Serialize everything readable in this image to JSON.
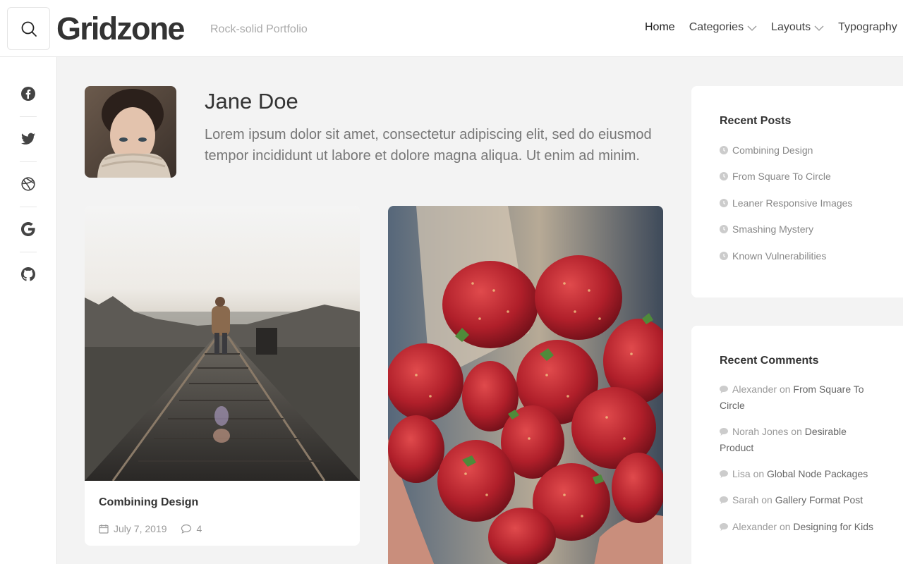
{
  "header": {
    "logo": "Gridzone",
    "tagline": "Rock-solid Portfolio",
    "search_icon": "search-icon",
    "nav": [
      {
        "label": "Home",
        "dropdown": false
      },
      {
        "label": "Categories",
        "dropdown": true
      },
      {
        "label": "Layouts",
        "dropdown": true
      },
      {
        "label": "Typography",
        "dropdown": false
      }
    ]
  },
  "social": [
    "facebook-icon",
    "twitter-icon",
    "dribbble-icon",
    "google-icon",
    "github-icon"
  ],
  "author": {
    "name": "Jane Doe",
    "bio": "Lorem ipsum dolor sit amet, consectetur adipiscing elit, sed do eiusmod tempor incididunt ut labore et dolore magna aliqua. Ut enim ad minim."
  },
  "posts": [
    {
      "title": "Combining Design",
      "date": "July 7, 2019",
      "comments": "4"
    }
  ],
  "recent_posts": {
    "title": "Recent Posts",
    "items": [
      "Combining Design",
      "From Square To Circle",
      "Leaner Responsive Images",
      "Smashing Mystery",
      "Known Vulnerabilities"
    ]
  },
  "recent_comments": {
    "title": "Recent Comments",
    "on_word": "on",
    "items": [
      {
        "author": "Alexander",
        "post": "From Square To Circle"
      },
      {
        "author": "Norah Jones",
        "post": "Desirable Product"
      },
      {
        "author": "Lisa",
        "post": "Global Node Packages"
      },
      {
        "author": "Sarah",
        "post": "Gallery Format Post"
      },
      {
        "author": "Alexander",
        "post": "Designing for Kids"
      }
    ]
  },
  "colors": {
    "background": "#f3f3f3",
    "text": "#333333",
    "muted": "#999999",
    "border": "#e6e6e6"
  }
}
